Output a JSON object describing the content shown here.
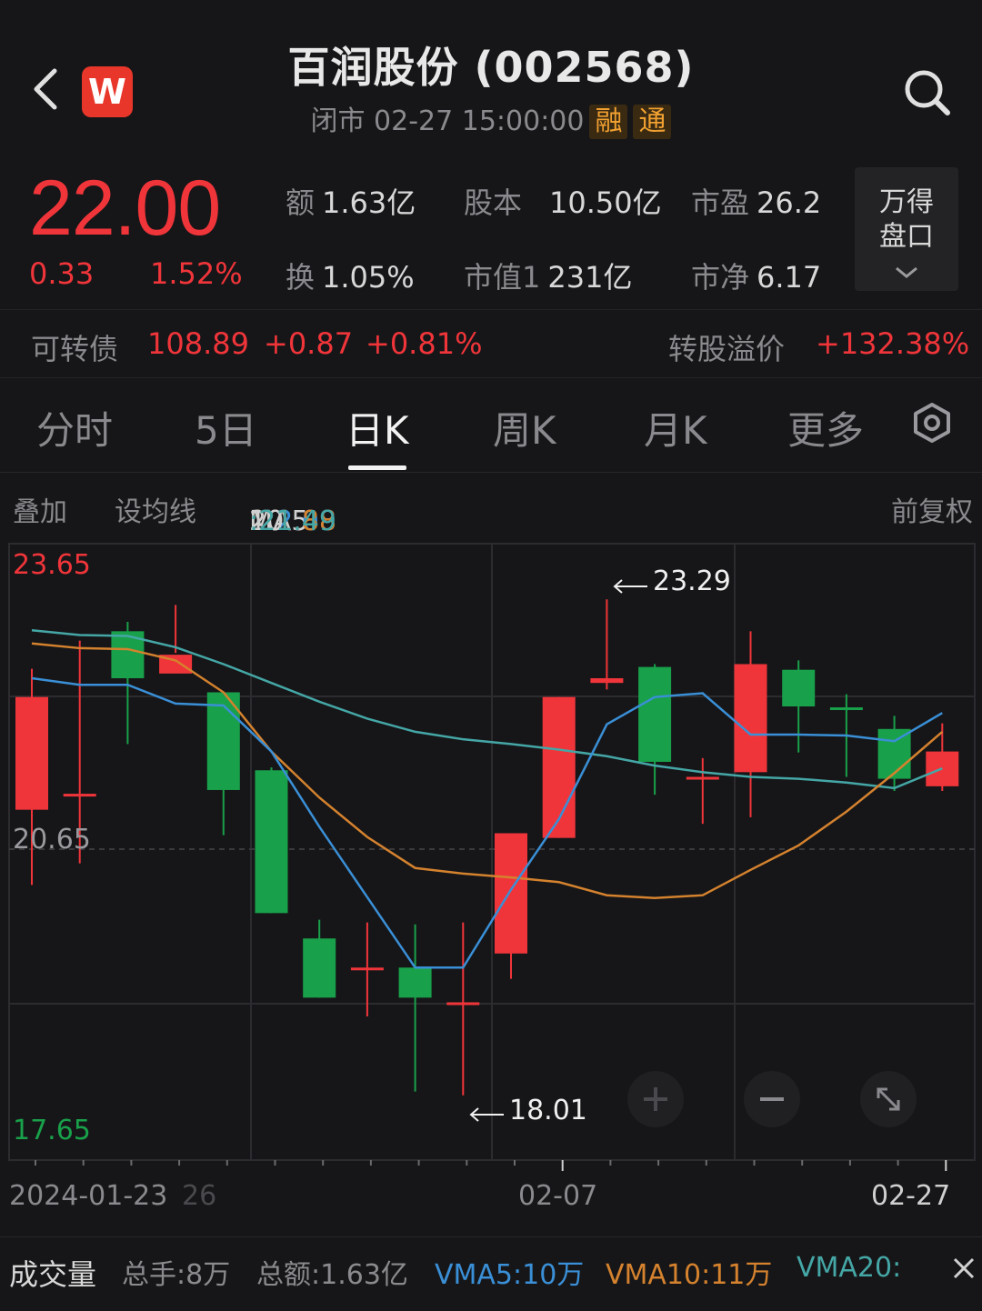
{
  "header": {
    "title": "百润股份 (002568)",
    "status_time": "闭市 02-27 15:00:00",
    "tag_rong": "融",
    "tag_tong": "通",
    "logo_letter": "W"
  },
  "quote": {
    "price": "22.00",
    "change": "0.33",
    "change_pct": "1.52%",
    "stats": {
      "amount": {
        "k": "额",
        "v": "1.63亿"
      },
      "share_cap": {
        "k": "股本",
        "v": "10.50亿"
      },
      "pe": {
        "k": "市盈",
        "v": "26.2"
      },
      "turnover": {
        "k": "换",
        "v": "1.05%"
      },
      "mkt_cap": {
        "k": "市值1",
        "v": "231亿"
      },
      "pb": {
        "k": "市净",
        "v": "6.17"
      }
    },
    "wind_panel_line1": "万得",
    "wind_panel_line2": "盘口"
  },
  "bond": {
    "label": "可转债",
    "price": "108.89",
    "change": "+0.87",
    "change_pct": "+0.81%",
    "premium_label": "转股溢价",
    "premium": "+132.38%"
  },
  "tabs": [
    {
      "label": "分时"
    },
    {
      "label": "5日"
    },
    {
      "label": "日K"
    },
    {
      "label": "周K"
    },
    {
      "label": "月K"
    },
    {
      "label": "更多"
    }
  ],
  "ma_row": {
    "overlay": "叠加",
    "set_ma": "设均线",
    "ma5_label": "MA5",
    "ma5_value": ":22.08",
    "ma10_label": "10",
    "ma10_value": ":21.88",
    "ma20_label": "20",
    "ma20_value": ":21.49",
    "adjust": "前复权"
  },
  "colors": {
    "up": "#f0353a",
    "down": "#19a04a",
    "ma5": "#3a8fd6",
    "ma10": "#d4822e",
    "ma20": "#45a6a6"
  },
  "chart_data": {
    "type": "candlestick",
    "y_labels": {
      "top": "23.65",
      "mid": "20.65",
      "bottom": "17.65"
    },
    "ylim": [
      17.65,
      23.65
    ],
    "x_labels": [
      "2024-01-23",
      "26",
      "02-07",
      "02-27"
    ],
    "annotations": {
      "high": "23.29",
      "low": "18.01"
    },
    "candles": [
      {
        "o": 21.05,
        "c": 22.25,
        "h": 22.55,
        "l": 20.25
      },
      {
        "o": 21.22,
        "c": 21.22,
        "h": 22.85,
        "l": 20.48
      },
      {
        "o": 22.95,
        "c": 22.45,
        "h": 23.05,
        "l": 21.75
      },
      {
        "o": 22.5,
        "c": 22.7,
        "h": 23.23,
        "l": 22.72
      },
      {
        "o": 22.3,
        "c": 21.26,
        "h": 22.3,
        "l": 20.78
      },
      {
        "o": 21.47,
        "c": 19.95,
        "h": 21.5,
        "l": 19.95
      },
      {
        "o": 19.68,
        "c": 19.05,
        "h": 19.88,
        "l": 19.05
      },
      {
        "o": 19.37,
        "c": 19.37,
        "h": 19.85,
        "l": 18.85
      },
      {
        "o": 19.37,
        "c": 19.05,
        "h": 19.83,
        "l": 18.05
      },
      {
        "o": 19.0,
        "c": 19.0,
        "h": 19.85,
        "l": 18.01
      },
      {
        "o": 19.52,
        "c": 20.8,
        "h": 20.8,
        "l": 19.25
      },
      {
        "o": 20.75,
        "c": 22.25,
        "h": 22.25,
        "l": 20.75
      },
      {
        "o": 22.4,
        "c": 22.45,
        "h": 23.29,
        "l": 22.33
      },
      {
        "o": 22.57,
        "c": 21.56,
        "h": 22.6,
        "l": 21.21
      },
      {
        "o": 21.4,
        "c": 21.4,
        "h": 21.6,
        "l": 20.9
      },
      {
        "o": 21.45,
        "c": 22.6,
        "h": 22.95,
        "l": 20.97
      },
      {
        "o": 22.54,
        "c": 22.15,
        "h": 22.64,
        "l": 21.66
      },
      {
        "o": 22.14,
        "c": 22.12,
        "h": 22.28,
        "l": 21.4
      },
      {
        "o": 21.91,
        "c": 21.38,
        "h": 22.05,
        "l": 21.25
      },
      {
        "o": 21.3,
        "c": 21.67,
        "h": 21.97,
        "l": 21.25
      }
    ],
    "ma5": [
      22.45,
      22.38,
      22.38,
      22.18,
      22.16,
      21.67,
      20.87,
      20.12,
      19.37,
      19.37,
      20.2,
      20.95,
      21.96,
      22.25,
      22.29,
      21.85,
      21.85,
      21.84,
      21.78,
      22.08
    ],
    "ma10": [
      22.82,
      22.77,
      22.76,
      22.64,
      22.3,
      21.67,
      21.18,
      20.76,
      20.43,
      20.37,
      20.33,
      20.28,
      20.14,
      20.11,
      20.14,
      20.41,
      20.67,
      21.03,
      21.44,
      21.88
    ],
    "ma20": [
      22.96,
      22.91,
      22.9,
      22.78,
      22.6,
      22.4,
      22.2,
      22.02,
      21.88,
      21.8,
      21.75,
      21.69,
      21.62,
      21.52,
      21.45,
      21.4,
      21.38,
      21.34,
      21.28,
      21.49
    ]
  },
  "volume": {
    "label": "成交量",
    "total_hands": "总手:8万",
    "total_amount": "总额:1.63亿",
    "vma5": "VMA5:10万",
    "vma10": "VMA10:11万",
    "vma20": "VMA20:"
  }
}
